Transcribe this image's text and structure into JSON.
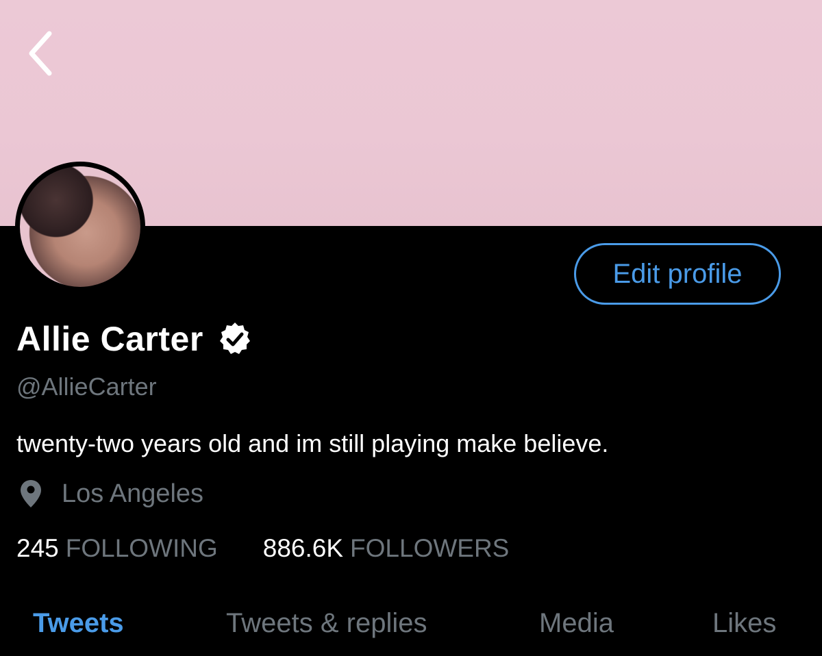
{
  "profile": {
    "display_name": "Allie Carter",
    "handle": "@AllieCarter",
    "bio": "twenty-two years old and im still playing make believe.",
    "location": "Los Angeles",
    "verified": true
  },
  "actions": {
    "edit_profile_label": "Edit profile"
  },
  "stats": {
    "following_count": "245",
    "following_label": "FOLLOWING",
    "followers_count": "886.6K",
    "followers_label": "FOLLOWERS"
  },
  "tabs": [
    {
      "label": "Tweets",
      "active": true
    },
    {
      "label": "Tweets & replies",
      "active": false
    },
    {
      "label": "Media",
      "active": false
    },
    {
      "label": "Likes",
      "active": false
    }
  ],
  "colors": {
    "accent": "#4a9be8",
    "banner": "#ebc7d4",
    "background": "#000000",
    "secondary_text": "#6e767d"
  },
  "icons": {
    "back": "chevron-left-icon",
    "verified": "verified-badge-icon",
    "location": "location-pin-icon"
  }
}
